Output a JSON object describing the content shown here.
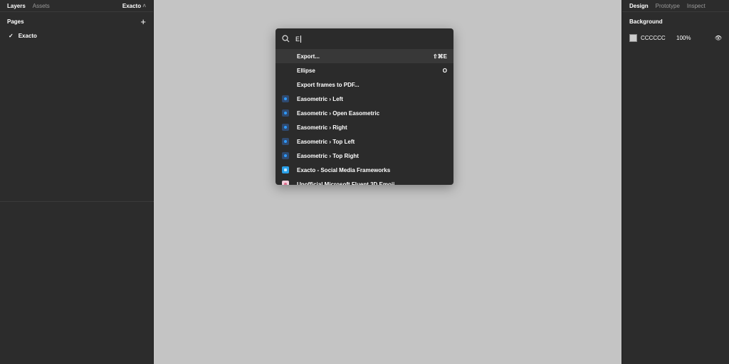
{
  "left_panel": {
    "tabs": [
      "Layers",
      "Assets"
    ],
    "file_name": "Exacto",
    "pages_label": "Pages",
    "pages": [
      "Exacto"
    ]
  },
  "right_panel": {
    "tabs": [
      "Design",
      "Prototype",
      "Inspect"
    ],
    "background_label": "Background",
    "bg_hex": "CCCCCC",
    "bg_opacity": "100%"
  },
  "palette": {
    "query": "E",
    "items": [
      {
        "label": "Export...",
        "shortcut": "⇧⌘E",
        "icon": "none"
      },
      {
        "label": "Ellipse",
        "shortcut": "O",
        "icon": "none"
      },
      {
        "label": "Export frames to PDF...",
        "shortcut": "",
        "icon": "none"
      },
      {
        "label": "Easometric › Left",
        "shortcut": "",
        "icon": "easometric-plugin"
      },
      {
        "label": "Easometric › Open Easometric",
        "shortcut": "",
        "icon": "easometric-plugin"
      },
      {
        "label": "Easometric › Right",
        "shortcut": "",
        "icon": "easometric-plugin"
      },
      {
        "label": "Easometric › Top Left",
        "shortcut": "",
        "icon": "easometric-plugin"
      },
      {
        "label": "Easometric › Top Right",
        "shortcut": "",
        "icon": "easometric-plugin"
      },
      {
        "label": "Exacto - Social Media Frameworks",
        "shortcut": "",
        "icon": "exacto-plugin"
      },
      {
        "label": "Unofficial Microsoft Fluent 3D Emoji",
        "shortcut": "",
        "icon": "emoji-plugin"
      }
    ]
  }
}
